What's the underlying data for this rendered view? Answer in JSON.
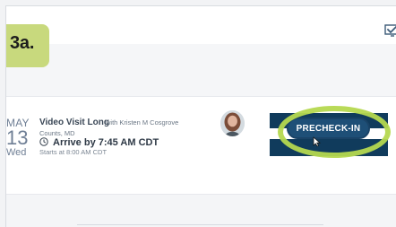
{
  "step": {
    "label": "3a."
  },
  "appointment": {
    "month": "MAY",
    "day": "13",
    "weekday": "Wed",
    "title": "Video Visit Long",
    "provider_prefix": "with Kristen M Cosgrove",
    "provider_suffix": "Counts, MD",
    "arrive": "Arrive by 7:45 AM CDT",
    "starts": "Starts at 8:00 AM CDT",
    "action_label": "PRECHECK-IN"
  },
  "icons": {
    "topbar": "checkin-icon",
    "arrive": "clock-icon",
    "pointer": "cursor-icon"
  },
  "colors": {
    "accent": "#103b5c",
    "button": "#1e4f77",
    "highlight": "#b5d84f",
    "step_badge": "#c8d97d"
  }
}
